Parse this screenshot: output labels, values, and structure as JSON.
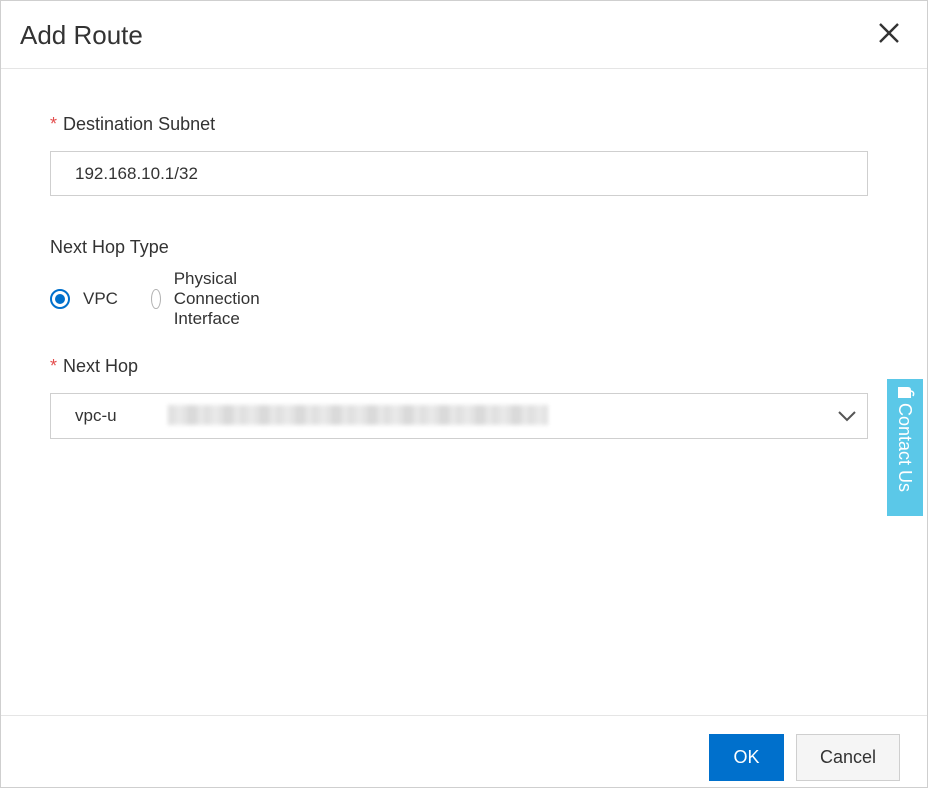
{
  "dialog": {
    "title": "Add Route",
    "close_icon": "close-icon"
  },
  "form": {
    "destination_subnet": {
      "required_mark": "*",
      "label": "Destination Subnet",
      "value": "192.168.10.1/32"
    },
    "next_hop_type": {
      "label": "Next Hop Type",
      "options": [
        {
          "label": "VPC",
          "selected": true
        },
        {
          "label": "Physical Connection Interface",
          "selected": false
        }
      ]
    },
    "next_hop": {
      "required_mark": "*",
      "label": "Next Hop",
      "value": "vpc-u",
      "dropdown_icon": "chevron-down-icon"
    }
  },
  "contact_widget": {
    "label": "Contact Us",
    "icon": "chat-icon",
    "color": "#5bc8e8"
  },
  "footer": {
    "ok_label": "OK",
    "cancel_label": "Cancel"
  },
  "colors": {
    "primary": "#0070cc",
    "required": "#e34d4d"
  }
}
